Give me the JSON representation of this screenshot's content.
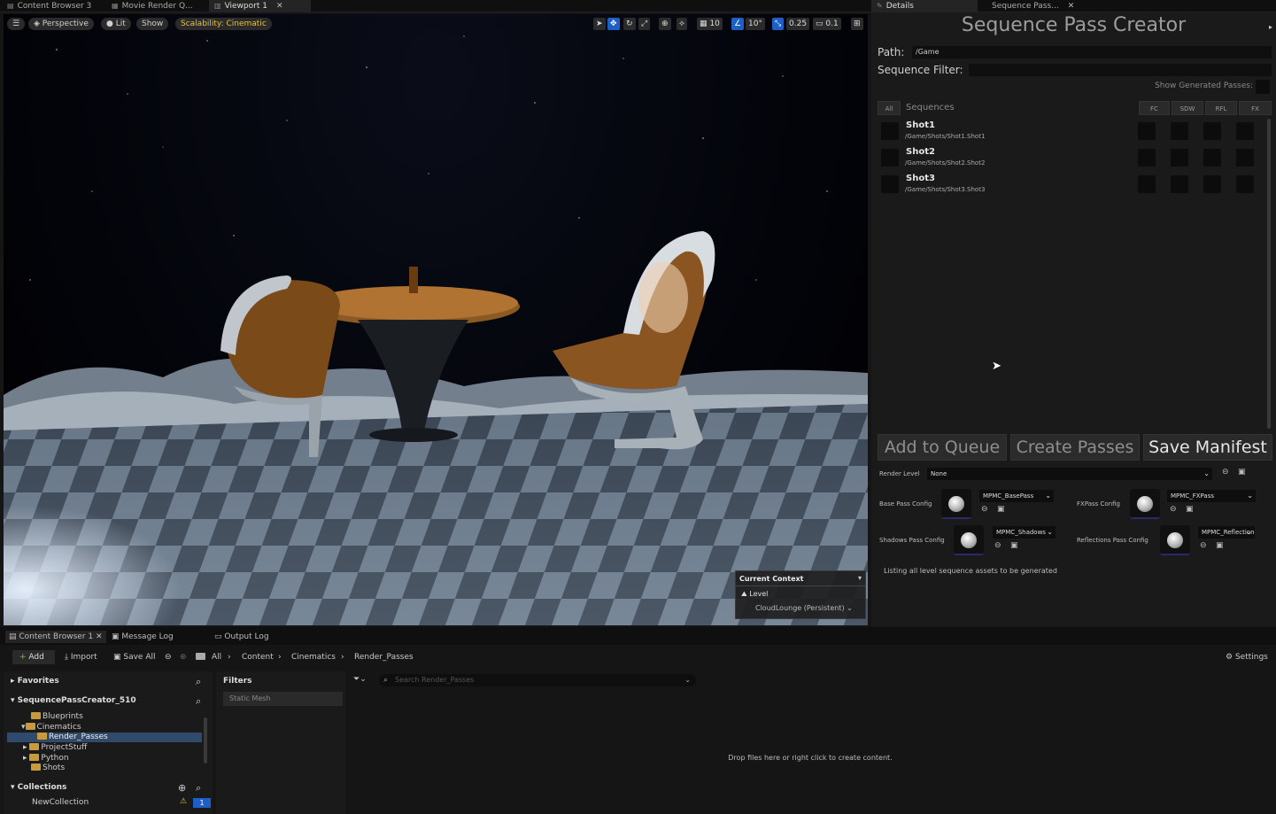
{
  "tabs": [
    {
      "label": "Content Browser 3",
      "icon": "content-browser-icon"
    },
    {
      "label": "Movie Render Q...",
      "icon": "movie-render-icon"
    },
    {
      "label": "Viewport 1",
      "icon": "viewport-icon"
    },
    {
      "label": "Details",
      "icon": "details-icon"
    },
    {
      "label": "Sequence Pass...",
      "icon": "tab-icon"
    }
  ],
  "viewport": {
    "perspective": "Perspective",
    "lit": "Lit",
    "show": "Show",
    "scalability": "Scalability: Cinematic",
    "grid": "10",
    "angle": "10°",
    "scale": "0.25",
    "camera_speed": "0.1",
    "context": {
      "title": "Current Context",
      "level_label": "Level",
      "level_value": "CloudLounge (Persistent)"
    }
  },
  "spc": {
    "title": "Sequence Pass Creator",
    "path_label": "Path:",
    "path_value": "/Game",
    "filter_label": "Sequence Filter:",
    "show_generated": "Show Generated Passes:",
    "all_btn": "All",
    "sequences_header": "Sequences",
    "columns": [
      "FC",
      "SDW",
      "RFL",
      "FX"
    ],
    "shots": [
      {
        "name": "Shot1",
        "path": "/Game/Shots/Shot1.Shot1"
      },
      {
        "name": "Shot2",
        "path": "/Game/Shots/Shot2.Shot2"
      },
      {
        "name": "Shot3",
        "path": "/Game/Shots/Shot3.Shot3"
      }
    ],
    "add_to_queue": "Add to Queue",
    "create_passes": "Create Passes",
    "save_manifest": "Save Manifest",
    "render_level_label": "Render Level",
    "render_level_value": "None",
    "configs": {
      "base_label": "Base Pass Config",
      "base_value": "MPMC_BasePass",
      "fx_label": "FXPass Config",
      "fx_value": "MPMC_FXPass",
      "shadows_label": "Shadows Pass Config",
      "shadows_value": "MPMC_Shadows",
      "reflections_label": "Reflections Pass Config",
      "reflections_value": "MPMC_Reflections"
    },
    "status": "Listing all level sequence assets to be generated"
  },
  "bottom": {
    "tabs": [
      "Content Browser 1",
      "Message Log",
      "Output Log"
    ],
    "add": "Add",
    "import": "Import",
    "save_all": "Save All",
    "breadcrumb": [
      "All",
      "Content",
      "Cinematics",
      "Render_Passes"
    ],
    "settings": "Settings",
    "favorites": "Favorites",
    "project": "SequencePassCreator_510",
    "tree": [
      "Blueprints",
      "Cinematics",
      "Render_Passes",
      "ProjectStuff",
      "Python",
      "Shots"
    ],
    "collections": "Collections",
    "collection_item": "NewCollection",
    "collection_count": "1",
    "filters": "Filters",
    "filter_chip": "Static Mesh",
    "search_placeholder": "Search Render_Passes",
    "empty_msg": "Drop files here or right click to create content."
  }
}
